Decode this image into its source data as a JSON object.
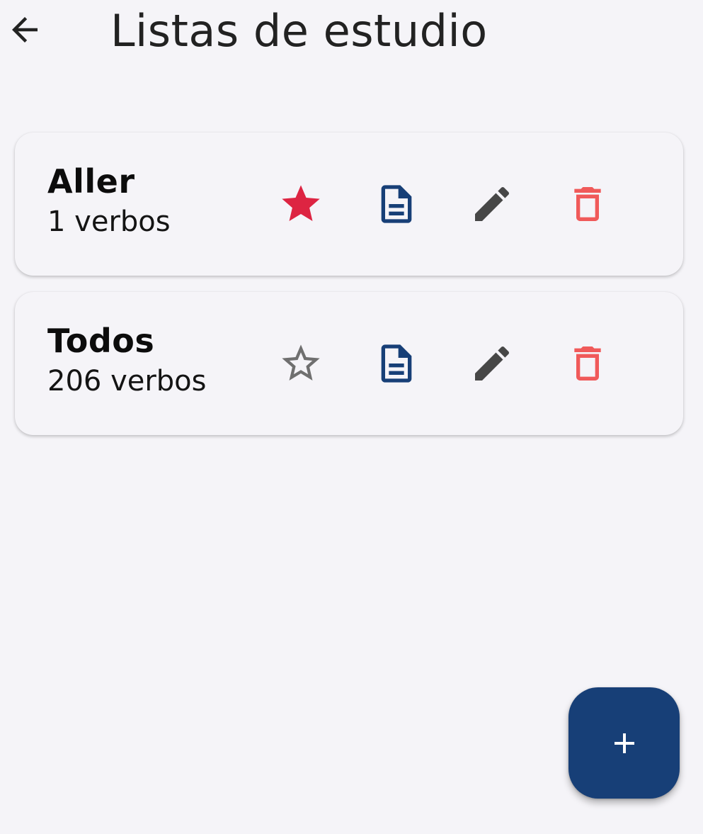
{
  "app_bar": {
    "title": "Listas de estudio",
    "back_icon": "arrow-left-icon"
  },
  "lists": [
    {
      "title": "Aller",
      "subtitle": "1 verbos",
      "favorite": true,
      "icons": [
        "star-filled-icon",
        "document-icon",
        "pencil-icon",
        "trash-icon"
      ]
    },
    {
      "title": "Todos",
      "subtitle": "206 verbos",
      "favorite": false,
      "icons": [
        "star-outline-icon",
        "document-icon",
        "pencil-icon",
        "trash-icon"
      ]
    }
  ],
  "fab": {
    "icon": "plus-icon"
  },
  "colors": {
    "background": "#f5f4f8",
    "favorite_star": "#dd2442",
    "outline_star": "#6f6f6f",
    "document": "#173f77",
    "edit": "#474747",
    "delete": "#f05a5a",
    "fab": "#173f77"
  }
}
